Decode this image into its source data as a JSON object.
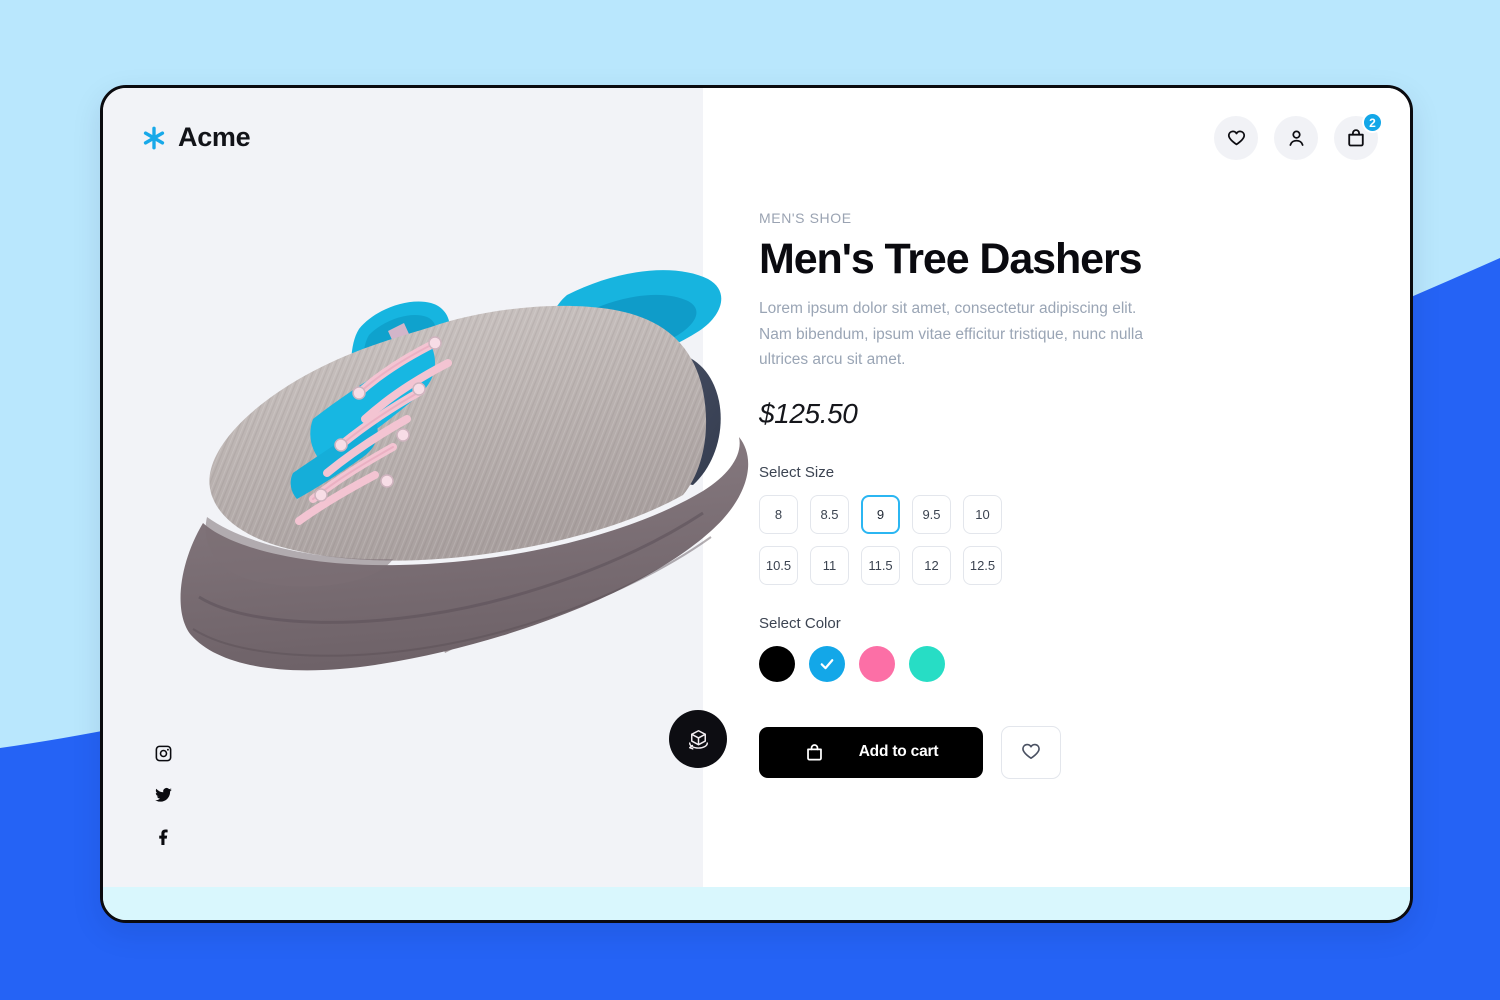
{
  "theme": {
    "page_background": "#b9e7fd",
    "accent_blue": "#2563f5",
    "brand_blue": "#13a7e8",
    "card_border": "#0b0b0f",
    "left_panel": "#f2f3f7",
    "footer_strip": "#d9f7fd",
    "selected_size_border": "#2bb6f2"
  },
  "header": {
    "brand_name": "Acme",
    "brand_logo_icon": "asterisk-icon",
    "actions": [
      {
        "name": "wishlist",
        "icon": "heart-icon"
      },
      {
        "name": "account",
        "icon": "user-icon"
      },
      {
        "name": "cart",
        "icon": "shopping-bag-icon",
        "badge": "2"
      }
    ]
  },
  "gallery": {
    "product_image_alt": "Men's Tree Dashers grey knit sneaker with cyan accents and pink laces",
    "view_3d_icon": "cube-rotate-icon",
    "social": [
      {
        "name": "instagram",
        "icon": "instagram-icon"
      },
      {
        "name": "twitter",
        "icon": "twitter-icon"
      },
      {
        "name": "facebook",
        "icon": "facebook-icon"
      }
    ]
  },
  "product": {
    "eyebrow": "MEN'S SHOE",
    "title": "Men's Tree Dashers",
    "description": "Lorem ipsum dolor sit amet, consectetur adipiscing elit. Nam bibendum, ipsum vitae efficitur tristique, nunc nulla ultrices arcu  sit amet.",
    "price": "$125.50"
  },
  "size_selector": {
    "label": "Select Size",
    "selected": "9",
    "options": [
      "8",
      "8.5",
      "9",
      "9.5",
      "10",
      "10.5",
      "11",
      "11.5",
      "12",
      "12.5"
    ]
  },
  "color_selector": {
    "label": "Select Color",
    "selected_index": 1,
    "options": [
      {
        "name": "black",
        "hex": "#000000"
      },
      {
        "name": "blue",
        "hex": "#13a7e8"
      },
      {
        "name": "pink",
        "hex": "#fc6fa6"
      },
      {
        "name": "teal",
        "hex": "#27ddc5"
      }
    ]
  },
  "actions": {
    "add_to_cart_label": "Add to cart",
    "add_to_cart_icon": "shopping-bag-icon",
    "wishlist_icon": "heart-icon"
  }
}
